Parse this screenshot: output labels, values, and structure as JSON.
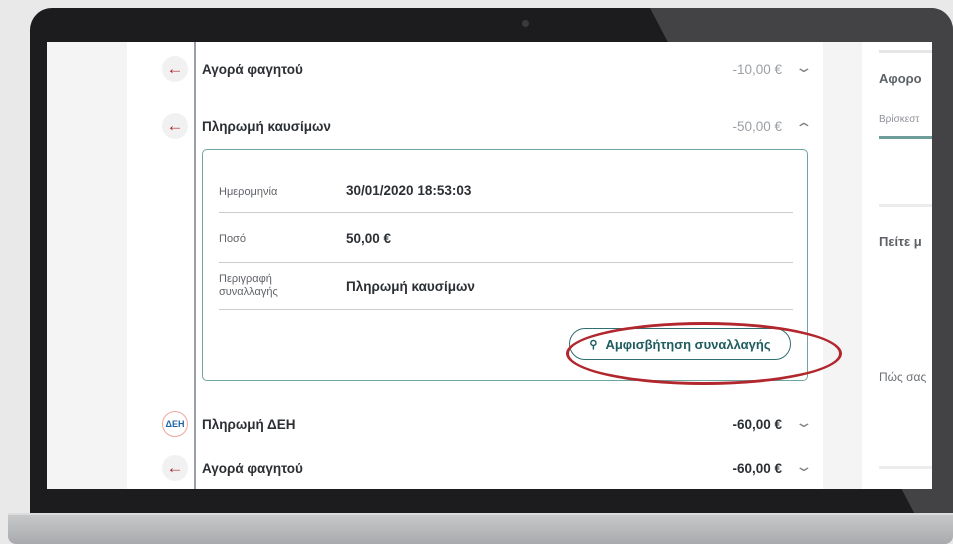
{
  "transactions": [
    {
      "label": "Αγορά φαγητού",
      "amount": "-10,00 €",
      "icon": "arrow-left-icon",
      "expanded": false
    },
    {
      "label": "Πληρωμή καυσίμων",
      "amount": "-50,00 €",
      "icon": "arrow-left-icon",
      "expanded": true
    },
    {
      "label": "Πληρωμή ΔΕΗ",
      "amount": "-60,00 €",
      "icon": "deh-logo-icon",
      "expanded": false
    },
    {
      "label": "Αγορά φαγητού",
      "amount": "-60,00 €",
      "icon": "arrow-left-icon",
      "expanded": false
    }
  ],
  "details": {
    "date_label": "Ημερομηνία",
    "date_value": "30/01/2020 18:53:03",
    "amount_label": "Ποσό",
    "amount_value": "50,00 €",
    "description_label_1": "Περιγραφή",
    "description_label_2": "συναλλαγής",
    "description_value": "Πληρωμή καυσίμων",
    "dispute_button": "Αμφισβήτηση συναλλαγής"
  },
  "deh_logo_text": "ΔΕΗ",
  "right_panel": {
    "heading1": "Αφορο",
    "sub1": "Βρίσκεστ",
    "heading2": "Πείτε μ",
    "text3": "Πώς σας"
  },
  "colors": {
    "accent": "#2f6e72",
    "highlight_ring": "#b1272d",
    "arrow": "#b1282e"
  }
}
